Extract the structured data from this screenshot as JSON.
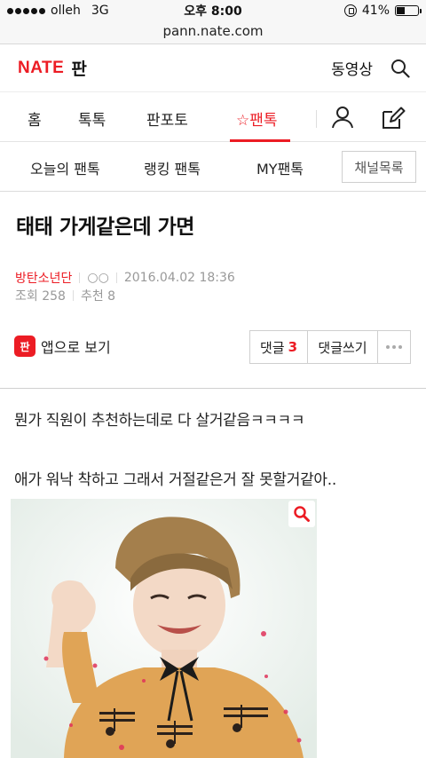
{
  "status": {
    "carrier": "olleh",
    "network": "3G",
    "time": "오후 8:00",
    "battery_text": "41%",
    "battery_level": 0.41
  },
  "browser": {
    "url": "pann.nate.com"
  },
  "header": {
    "logo_nate": "NATE",
    "logo_pan": "판",
    "video_label": "동영상"
  },
  "main_nav": {
    "items": [
      "홈",
      "톡톡",
      "판포토",
      "☆팬톡"
    ],
    "active_index": 3
  },
  "sub_nav": {
    "items": [
      "오늘의 팬톡",
      "랭킹 팬톡",
      "MY팬톡"
    ],
    "channel_button": "채널목록"
  },
  "article": {
    "title": "태태 가게같은데 가면",
    "author": "방탄소년단",
    "nickname": "○○",
    "date": "2016.04.02 18:36",
    "views": "조회 258",
    "recommends": "추천 8",
    "app_icon_text": "판",
    "app_view_label": "앱으로 보기",
    "comment_label": "댓글",
    "comment_count": "3",
    "write_comment_label": "댓글쓰기",
    "body": [
      "뭔가 직원이 추천하는데로 다 살거같음ㅋㅋㅋㅋ",
      "애가 워낙 착하고 그래서 거절같은거 잘 못할거같아.."
    ]
  },
  "colors": {
    "accent": "#ec1c24"
  }
}
